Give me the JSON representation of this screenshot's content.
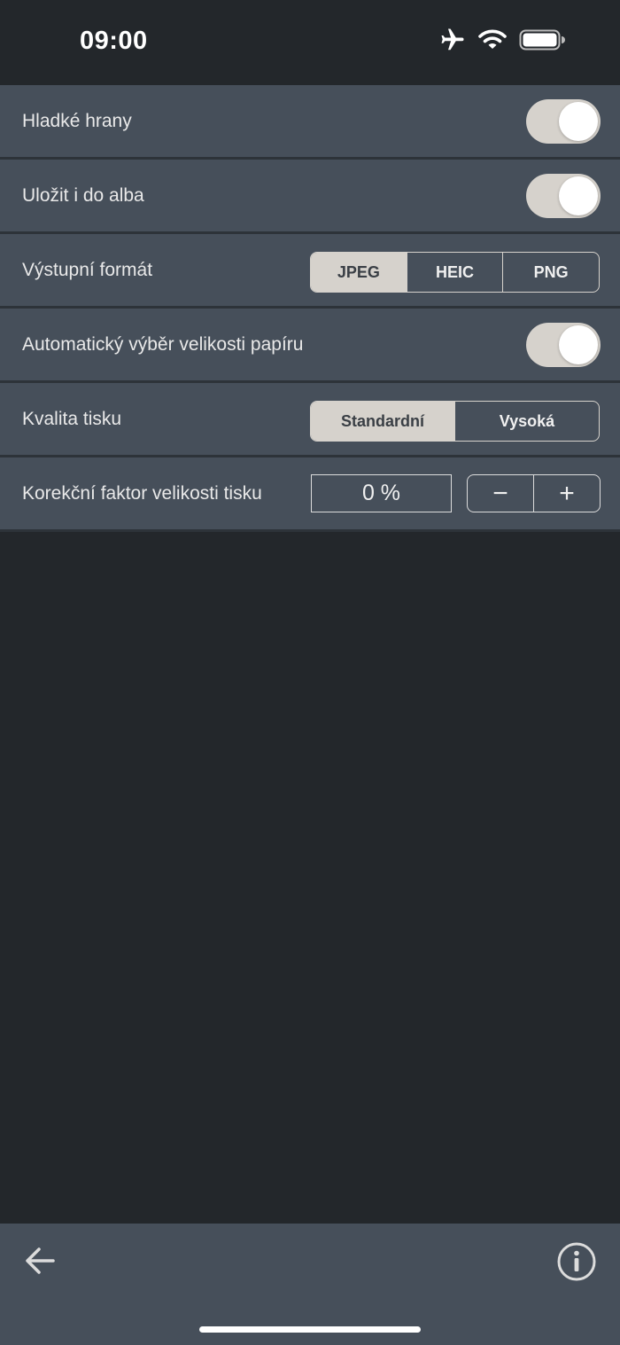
{
  "status_bar": {
    "time": "09:00",
    "icons": [
      "airplane-icon",
      "wifi-icon",
      "battery-icon"
    ]
  },
  "settings": {
    "smooth_edges": {
      "label": "Hladké hrany",
      "on": true
    },
    "save_to_album": {
      "label": "Uložit i do alba",
      "on": true
    },
    "output_format": {
      "label": "Výstupní formát",
      "options": [
        "JPEG",
        "HEIC",
        "PNG"
      ],
      "selected": "JPEG"
    },
    "auto_paper_size": {
      "label": "Automatický výběr velikosti papíru",
      "on": true
    },
    "print_quality": {
      "label": "Kvalita tisku",
      "options": [
        "Standardní",
        "Vysoká"
      ],
      "selected": "Standardní"
    },
    "print_size_correction": {
      "label": "Korekční faktor velikosti tisku",
      "value": "0 %",
      "decrement": "−",
      "increment": "+"
    }
  },
  "bottom_bar": {
    "back_icon": "arrow-left-icon",
    "info_icon": "info-icon"
  },
  "colors": {
    "background": "#23272b",
    "row": "#464f5a",
    "accent": "#d6d2cc"
  }
}
